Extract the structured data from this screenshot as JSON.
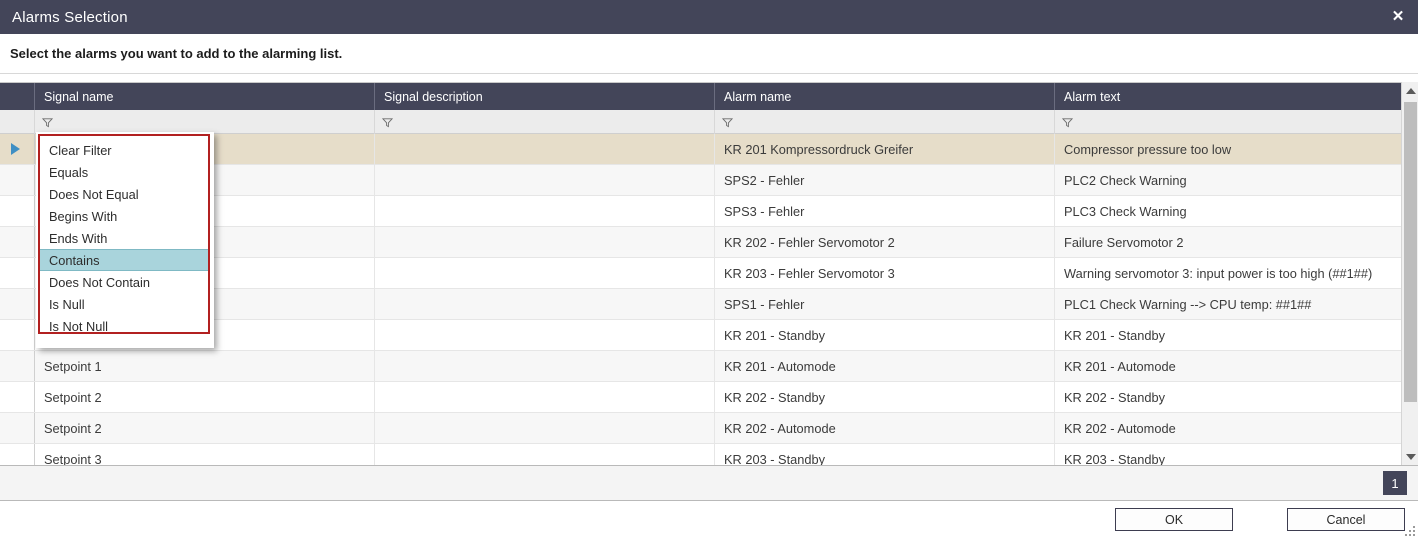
{
  "window": {
    "title": "Alarms Selection",
    "close_icon": "close-icon",
    "subtitle": "Select the alarms you want to add to the alarming list."
  },
  "grid": {
    "columns": [
      {
        "key": "row_header",
        "label": ""
      },
      {
        "key": "signal_name",
        "label": "Signal name"
      },
      {
        "key": "signal_description",
        "label": "Signal description"
      },
      {
        "key": "alarm_name",
        "label": "Alarm name"
      },
      {
        "key": "alarm_text",
        "label": "Alarm text"
      }
    ],
    "filter_row": {
      "icon": "filter-funnel-icon",
      "signal_name_filter": "",
      "signal_description_filter": "",
      "alarm_name_filter": "",
      "alarm_text_filter": ""
    },
    "rows": [
      {
        "selected": true,
        "signal_name": "",
        "signal_description": "",
        "alarm_name": "KR 201 Kompressordruck Greifer",
        "alarm_text": "Compressor pressure too low"
      },
      {
        "selected": false,
        "signal_name": "",
        "signal_description": "",
        "alarm_name": "SPS2 - Fehler",
        "alarm_text": "PLC2 Check Warning"
      },
      {
        "selected": false,
        "signal_name": "",
        "signal_description": "",
        "alarm_name": "SPS3 - Fehler",
        "alarm_text": "PLC3 Check Warning"
      },
      {
        "selected": false,
        "signal_name": "",
        "signal_description": "",
        "alarm_name": "KR 202 - Fehler Servomotor 2",
        "alarm_text": "Failure Servomotor 2"
      },
      {
        "selected": false,
        "signal_name": "",
        "signal_description": "",
        "alarm_name": "KR 203 - Fehler Servomotor 3",
        "alarm_text": "Warning servomotor 3: input power is too high (##1##)"
      },
      {
        "selected": false,
        "signal_name": "",
        "signal_description": "",
        "alarm_name": "SPS1 - Fehler",
        "alarm_text": "PLC1 Check Warning --> CPU temp: ##1##"
      },
      {
        "selected": false,
        "signal_name": "",
        "signal_description": "",
        "alarm_name": "KR 201 - Standby",
        "alarm_text": "KR 201 - Standby"
      },
      {
        "selected": false,
        "signal_name": "Setpoint 1",
        "signal_description": "",
        "alarm_name": "KR 201 - Automode",
        "alarm_text": "KR 201 - Automode"
      },
      {
        "selected": false,
        "signal_name": "Setpoint 2",
        "signal_description": "",
        "alarm_name": "KR 202 - Standby",
        "alarm_text": "KR 202 - Standby"
      },
      {
        "selected": false,
        "signal_name": "Setpoint 2",
        "signal_description": "",
        "alarm_name": "KR 202 - Automode",
        "alarm_text": "KR 202 - Automode"
      },
      {
        "selected": false,
        "signal_name": "Setpoint 3",
        "signal_description": "",
        "alarm_name": "KR 203 - Standby",
        "alarm_text": "KR 203 - Standby"
      }
    ]
  },
  "filter_dropdown": {
    "items": [
      {
        "label": "Clear Filter",
        "active": false
      },
      {
        "label": "Equals",
        "active": false
      },
      {
        "label": "Does Not Equal",
        "active": false
      },
      {
        "label": "Begins With",
        "active": false
      },
      {
        "label": "Ends With",
        "active": false
      },
      {
        "label": "Contains",
        "active": true
      },
      {
        "label": "Does Not Contain",
        "active": false
      },
      {
        "label": "Is Null",
        "active": false
      },
      {
        "label": "Is Not Null",
        "active": false
      }
    ]
  },
  "pager": {
    "current_page": "1"
  },
  "footer": {
    "ok_label": "OK",
    "cancel_label": "Cancel"
  },
  "colors": {
    "titlebar_bg": "#434559",
    "header_bg": "#434559",
    "selected_row_bg": "#e6ddc9",
    "dropdown_border": "#b22020",
    "dropdown_active_bg": "#a9d4dc",
    "selector_arrow": "#3f8fc4"
  }
}
